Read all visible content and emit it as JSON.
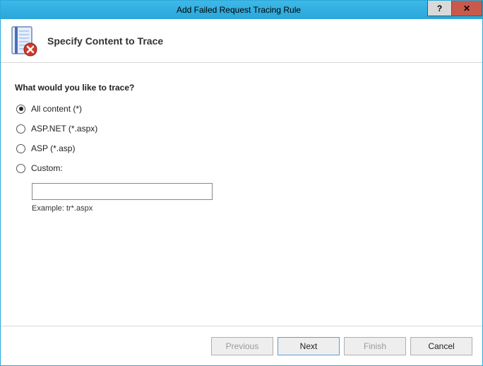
{
  "window": {
    "title": "Add Failed Request Tracing Rule"
  },
  "header": {
    "title": "Specify Content to Trace"
  },
  "content": {
    "prompt": "What would you like to trace?",
    "options": {
      "all": "All content (*)",
      "aspnet": "ASP.NET (*.aspx)",
      "asp": "ASP (*.asp)",
      "custom": "Custom:"
    },
    "custom_value": "",
    "example": "Example: tr*.aspx"
  },
  "buttons": {
    "previous": "Previous",
    "next": "Next",
    "finish": "Finish",
    "cancel": "Cancel"
  }
}
